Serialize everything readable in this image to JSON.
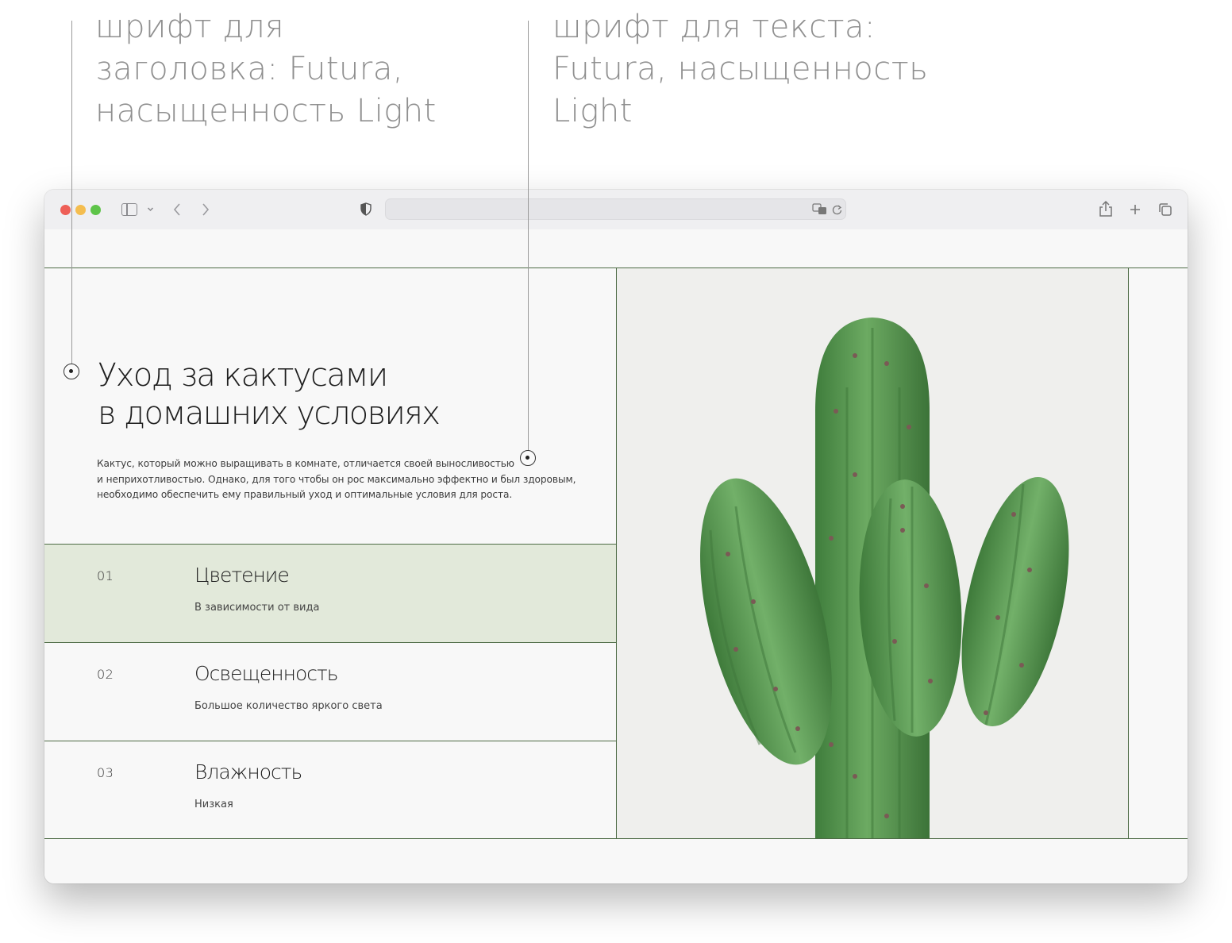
{
  "annotations": {
    "heading_font": [
      "шрифт для",
      "заголовка: Futura,",
      "насыщенность Light"
    ],
    "body_font": [
      "шрифт для текста:",
      "Futura, насыщенность",
      "Light"
    ]
  },
  "browser": {
    "url": ""
  },
  "hero": {
    "title_lines": [
      "Уход за кактусами",
      "в домашних условиях"
    ],
    "description_lines": [
      "Кактус, который можно выращивать в комнате, отличается своей выносливостью",
      "и неприхотливостью. Однако, для того чтобы он рос максимально эффектно и был здоровым,",
      "необходимо обеспечить ему правильный уход и оптимальные условия для роста."
    ]
  },
  "features": [
    {
      "num": "01",
      "title": "Цветение",
      "subtitle": "В зависимости от вида",
      "active": true
    },
    {
      "num": "02",
      "title": "Освещенность",
      "subtitle": "Большое количество яркого света",
      "active": false
    },
    {
      "num": "03",
      "title": "Влажность",
      "subtitle": "Низкая",
      "active": false
    }
  ],
  "colors": {
    "accent_line": "#4d6b45",
    "active_row": "#e2e9da",
    "cactus_green": "#5f9c58"
  }
}
